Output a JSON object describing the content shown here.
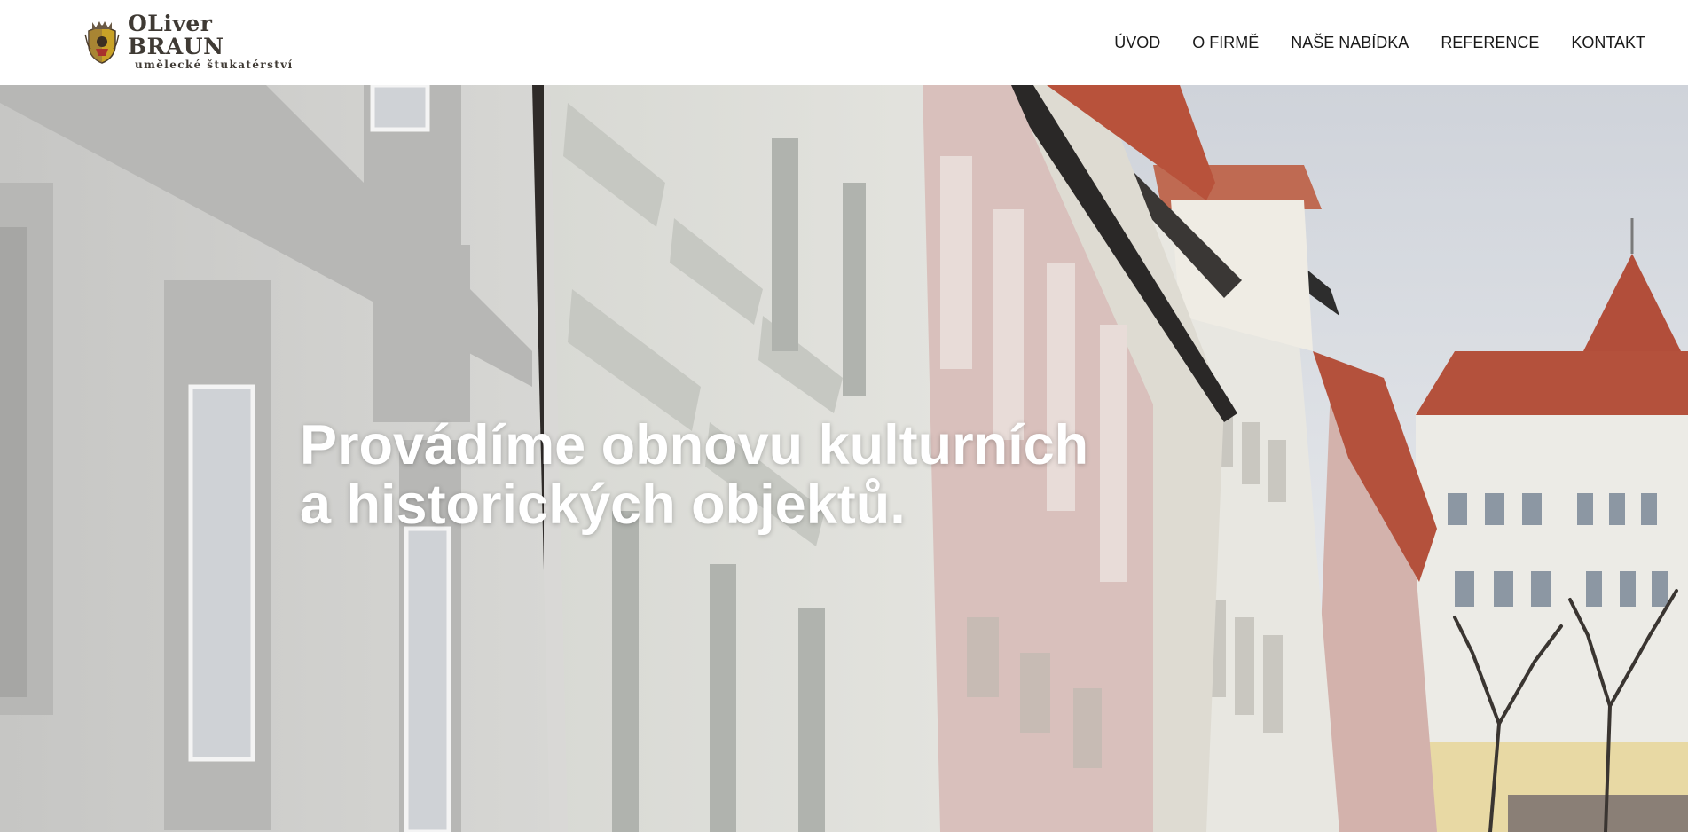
{
  "header": {
    "logo": {
      "name": "OLiver BRAUN",
      "subtitle": "umělecké štukatérství",
      "icon": "coat-of-arms-crest"
    },
    "nav": {
      "items": [
        {
          "label": "ÚVOD"
        },
        {
          "label": "O FIRMĚ"
        },
        {
          "label": "NAŠE NABÍDKA"
        },
        {
          "label": "REFERENCE"
        },
        {
          "label": "KONTAKT"
        }
      ]
    }
  },
  "hero": {
    "title_line_1": "Provádíme obnovu kulturních",
    "title_line_2": "a historických objektů.",
    "image": "historic-building-facades-street"
  },
  "colors": {
    "header_bg": "#ffffff",
    "nav_text": "#1a1a1a",
    "logo_text": "#3f3a34",
    "hero_title": "#ffffff",
    "roof_red": "#b4513c"
  }
}
